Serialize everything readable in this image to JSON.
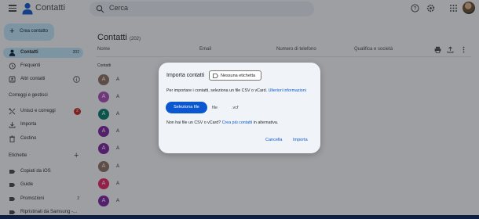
{
  "header": {
    "app_title": "Contatti",
    "search_placeholder": "Cerca",
    "icons": [
      "help-icon",
      "settings-icon",
      "apps-icon"
    ]
  },
  "sidebar": {
    "create_label": "Crea contatto",
    "items": [
      {
        "label": "Contatti",
        "count": "202",
        "icon": "person-icon",
        "active": true
      },
      {
        "label": "Frequenti",
        "icon": "history-icon"
      },
      {
        "label": "Altri contatti",
        "icon": "contacts-icon"
      }
    ],
    "fix_section": "Correggi e gestisci",
    "fix_items": [
      {
        "label": "Unisci e correggi",
        "badge": "2",
        "icon": "merge-icon"
      },
      {
        "label": "Importa",
        "icon": "import-icon"
      },
      {
        "label": "Cestino",
        "icon": "trash-icon"
      }
    ],
    "labels_section": "Etichette",
    "labels": [
      {
        "label": "Copiati da iOS"
      },
      {
        "label": "Guide"
      },
      {
        "label": "Promozioni",
        "count": "2"
      },
      {
        "label": "Ripristinati da Samsung -..."
      }
    ]
  },
  "main": {
    "title": "Contatti",
    "count": "(202)",
    "columns": [
      "Nome",
      "Email",
      "Numero di telefono",
      "Qualifica e società"
    ],
    "group_label": "Contatti",
    "rows": [
      {
        "initial": "A",
        "name": "A",
        "color": "#8d6e63"
      },
      {
        "initial": "A",
        "name": "A",
        "color": "#ab47bc"
      },
      {
        "initial": "A",
        "name": "A",
        "color": "#00796b"
      },
      {
        "initial": "A",
        "name": "A",
        "color": "#7b1fa2"
      },
      {
        "initial": "A",
        "name": "A",
        "color": "#7b1fa2"
      },
      {
        "initial": "A",
        "name": "A",
        "color": "#8d6e63"
      },
      {
        "initial": "A",
        "name": "A",
        "color": "#e91e63"
      },
      {
        "initial": "A",
        "name": "A",
        "color": "#7b1fa2"
      }
    ]
  },
  "dialog": {
    "title": "Importa contatti",
    "label_chip": "Nessuna etichetta",
    "description": "Per importare i contatti, seleziona un file CSV o vCard.",
    "learn_more": "Ulteriori informazioni",
    "select_file": "Seleziona file",
    "file_status": "file",
    "file_ext": ".vcf",
    "alt_text": "Non hai file un CSV o vCard?",
    "alt_link": "Crea più contatti",
    "alt_suffix": "in alternativa.",
    "cancel": "Cancella",
    "import": "Importa"
  },
  "colors": {
    "accent": "#0b57d0",
    "active_nav": "#c2e7ff",
    "badge": "#c5221f"
  }
}
